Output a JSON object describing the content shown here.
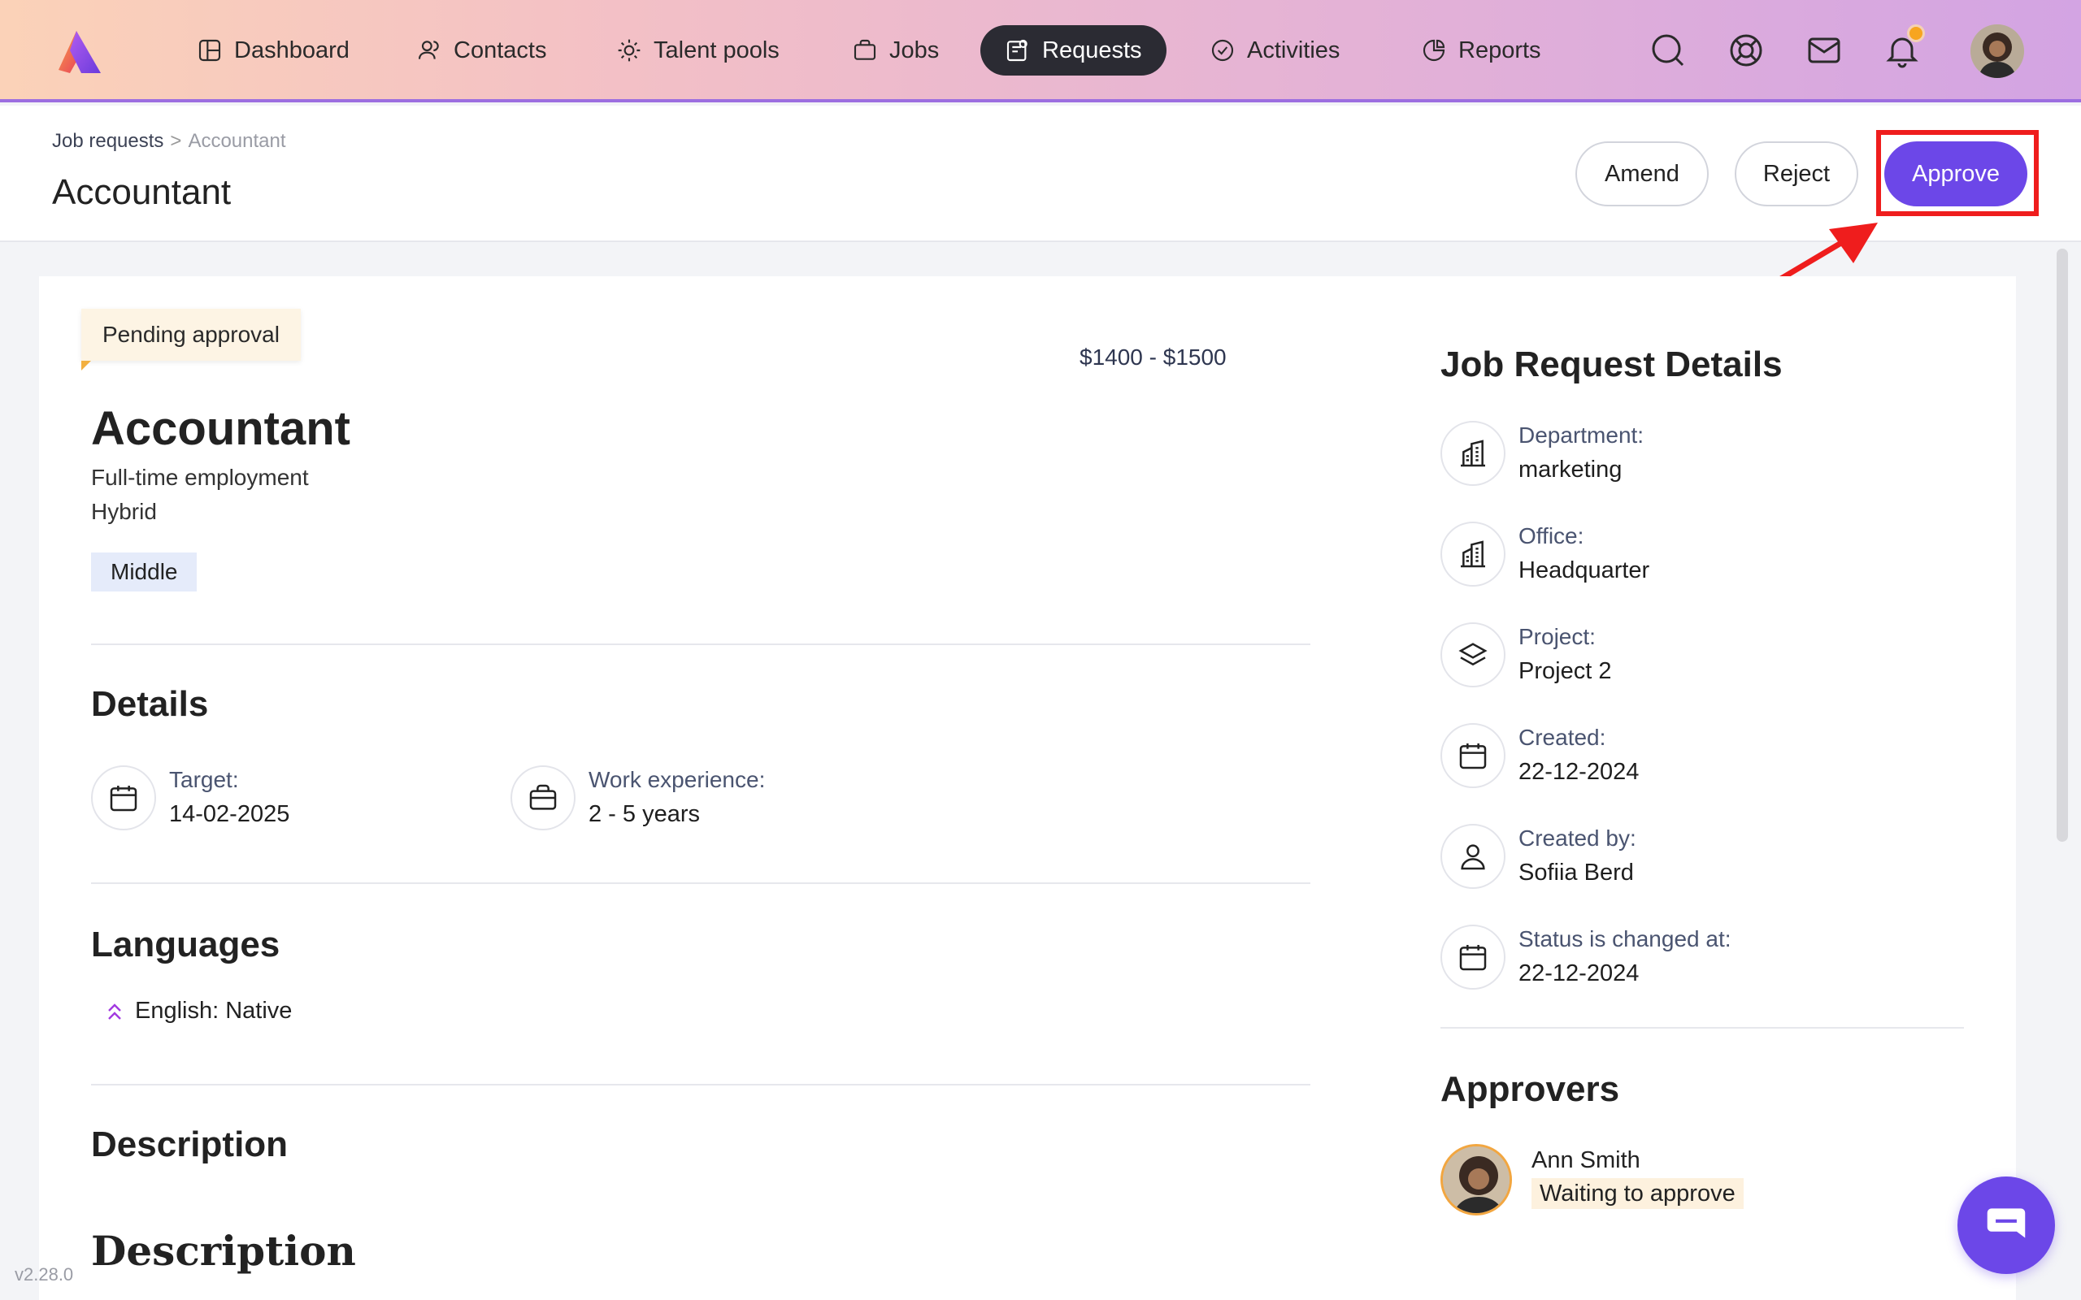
{
  "nav": {
    "items": [
      {
        "label": "Dashboard",
        "icon": "dashboard-icon"
      },
      {
        "label": "Contacts",
        "icon": "contacts-icon"
      },
      {
        "label": "Talent pools",
        "icon": "sun-icon"
      },
      {
        "label": "Jobs",
        "icon": "briefcase-icon"
      },
      {
        "label": "Requests",
        "icon": "requests-icon",
        "active": true
      },
      {
        "label": "Activities",
        "icon": "check-circle-icon"
      },
      {
        "label": "Reports",
        "icon": "reports-icon"
      }
    ]
  },
  "header": {
    "breadcrumb": {
      "parent": "Job requests",
      "separator": ">",
      "current": "Accountant"
    },
    "title": "Accountant",
    "amend_label": "Amend",
    "reject_label": "Reject",
    "approve_label": "Approve"
  },
  "job": {
    "status": "Pending approval",
    "salary": "$1400 - $1500",
    "title": "Accountant",
    "employment_type": "Full-time employment",
    "work_mode": "Hybrid",
    "level": "Middle"
  },
  "details": {
    "title": "Details",
    "target_label": "Target:",
    "target_value": "14-02-2025",
    "experience_label": "Work experience:",
    "experience_value": "2 - 5 years"
  },
  "languages": {
    "title": "Languages",
    "items": [
      {
        "text": "English: Native"
      }
    ]
  },
  "description": {
    "title": "Description",
    "body_heading": "Description"
  },
  "job_request_details": {
    "title": "Job Request Details",
    "rows": [
      {
        "label": "Department:",
        "value": "marketing",
        "icon": "building-icon"
      },
      {
        "label": "Office:",
        "value": "Headquarter",
        "icon": "building-icon"
      },
      {
        "label": "Project:",
        "value": "Project 2",
        "icon": "layers-icon"
      },
      {
        "label": "Created:",
        "value": "22-12-2024",
        "icon": "calendar-icon"
      },
      {
        "label": "Created by:",
        "value": "Sofiia Berd",
        "icon": "user-icon"
      },
      {
        "label": "Status is changed at:",
        "value": "22-12-2024",
        "icon": "calendar-icon"
      }
    ]
  },
  "approvers": {
    "title": "Approvers",
    "items": [
      {
        "name": "Ann Smith",
        "status": "Waiting to approve"
      }
    ]
  },
  "version": "v2.28.0",
  "colors": {
    "accent": "#6c47e8",
    "highlight": "#ef1d1d",
    "nav_active": "#2b2b33"
  }
}
